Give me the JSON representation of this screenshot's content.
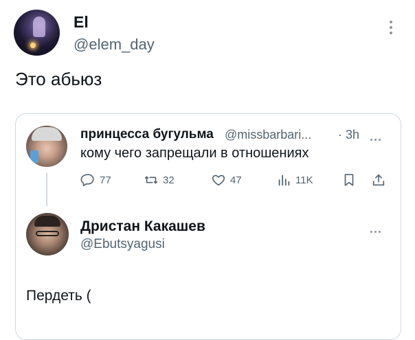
{
  "tweet": {
    "author_name": "El",
    "author_handle": "@elem_day",
    "text": "Это абьюз"
  },
  "quoted": {
    "author_name": "принцесса бугульма",
    "author_handle": "@missbarbari...",
    "time": "· 3h",
    "text": "кому чего запрещали в отношениях",
    "actions": {
      "replies": "77",
      "retweets": "32",
      "likes": "47",
      "views": "11K"
    }
  },
  "reply": {
    "author_name": "Дристан Какашев",
    "author_handle": "@Ebutsyagusi",
    "text": "Пердеть ("
  },
  "icons": {
    "reply": "comment-icon",
    "retweet": "retweet-icon",
    "like": "heart-icon",
    "views": "views-chart-icon",
    "bookmark": "bookmark-icon",
    "share": "share-icon",
    "more": "more-icon"
  }
}
